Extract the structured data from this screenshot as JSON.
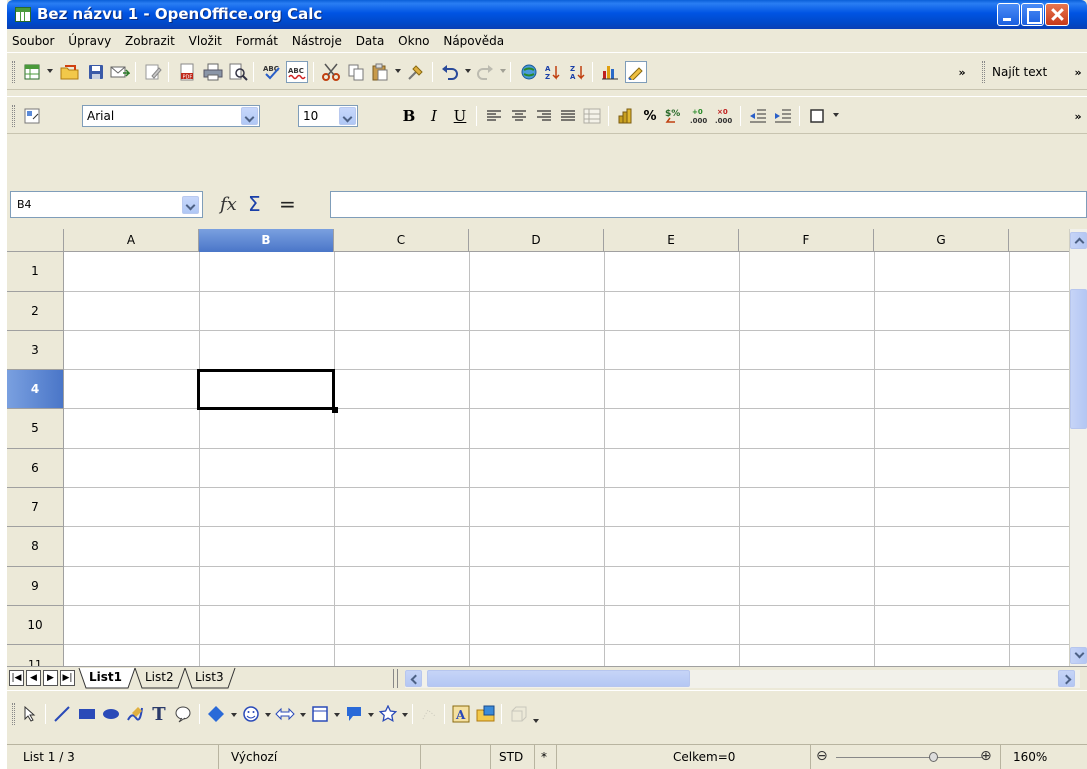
{
  "window": {
    "title": "Bez názvu 1 - OpenOffice.org Calc"
  },
  "menu": {
    "items": [
      "Soubor",
      "Úpravy",
      "Zobrazit",
      "Vložit",
      "Formát",
      "Nástroje",
      "Data",
      "Okno",
      "Nápověda"
    ]
  },
  "standard_toolbar": {
    "find_text_label": "Najít text"
  },
  "formatting_toolbar": {
    "font_name": "Arial",
    "font_size": "10",
    "bold_label": "B",
    "italic_label": "I",
    "underline_label": "U"
  },
  "formula_bar": {
    "name_box": "B4",
    "function_wizard_symbol": "fx",
    "sum_symbol": "Σ",
    "function_symbol": "=",
    "formula": ""
  },
  "sheet": {
    "columns": [
      "A",
      "B",
      "C",
      "D",
      "E",
      "F",
      "G"
    ],
    "rows": [
      "1",
      "2",
      "3",
      "4",
      "5",
      "6",
      "7",
      "8",
      "9",
      "10",
      "11"
    ],
    "active_column": "B",
    "active_row": "4"
  },
  "sheet_tabs": {
    "tabs": [
      "List1",
      "List2",
      "List3"
    ],
    "active": "List1"
  },
  "status_bar": {
    "sheet_position": "List 1 / 3",
    "page_style": "Výchozí",
    "selection_mode": "STD",
    "modified_flag": "*",
    "sum": "Celkem=0",
    "zoom": "160%"
  },
  "colors": {
    "titlebar": "#0054e3",
    "chrome": "#ece9d8",
    "active_header": "#4a76c8",
    "gridline": "#c0c0c0"
  }
}
